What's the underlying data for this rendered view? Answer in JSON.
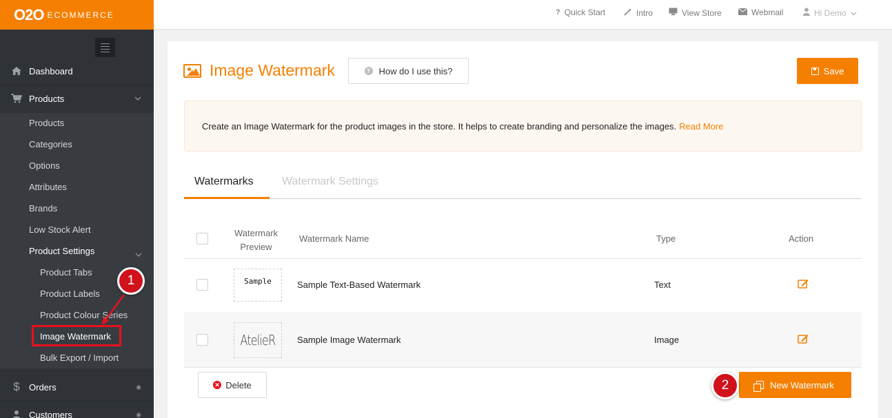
{
  "brand": {
    "main": "O2O",
    "sub": "ECOMMERCE"
  },
  "colors": {
    "accent": "#f57f00",
    "sidebar": "#2f3338",
    "callout": "#d1111c"
  },
  "topbar": {
    "items": [
      {
        "label": "Quick Start",
        "icon": "question-icon"
      },
      {
        "label": "Intro",
        "icon": "magic-wand-icon"
      },
      {
        "label": "View Store",
        "icon": "desktop-icon"
      },
      {
        "label": "Webmail",
        "icon": "envelope-icon"
      },
      {
        "label": "Hi Demo",
        "icon": "user-icon"
      }
    ]
  },
  "sidebar": {
    "dashboard": "Dashboard",
    "products": "Products",
    "sub_items": [
      "Products",
      "Categories",
      "Options",
      "Attributes",
      "Brands",
      "Low Stock Alert",
      "Product Settings"
    ],
    "settings_items": [
      "Product Tabs",
      "Product Labels",
      "Product Colour Series",
      "Image Watermark",
      "Bulk Export / Import"
    ],
    "orders": "Orders",
    "customers": "Customers"
  },
  "callouts": [
    "1",
    "2"
  ],
  "page": {
    "title": "Image Watermark",
    "help_label": "How do I use this?",
    "save_label": "Save",
    "info_text": "Create an Image Watermark for the product images in the store. It helps to create branding and personalize the images.",
    "info_link": "Read More"
  },
  "tabs": [
    {
      "label": "Watermarks",
      "active": true
    },
    {
      "label": "Watermark Settings",
      "active": false
    }
  ],
  "table": {
    "headers": {
      "preview_line1": "Watermark",
      "preview_line2": "Preview",
      "name": "Watermark Name",
      "type": "Type",
      "action": "Action"
    },
    "rows": [
      {
        "preview": "Sample",
        "name": "Sample Text-Based Watermark",
        "type": "Text"
      },
      {
        "preview": "AtelieR",
        "name": "Sample Image Watermark",
        "type": "Image"
      }
    ]
  },
  "buttons": {
    "delete": "Delete",
    "new": "New Watermark"
  }
}
